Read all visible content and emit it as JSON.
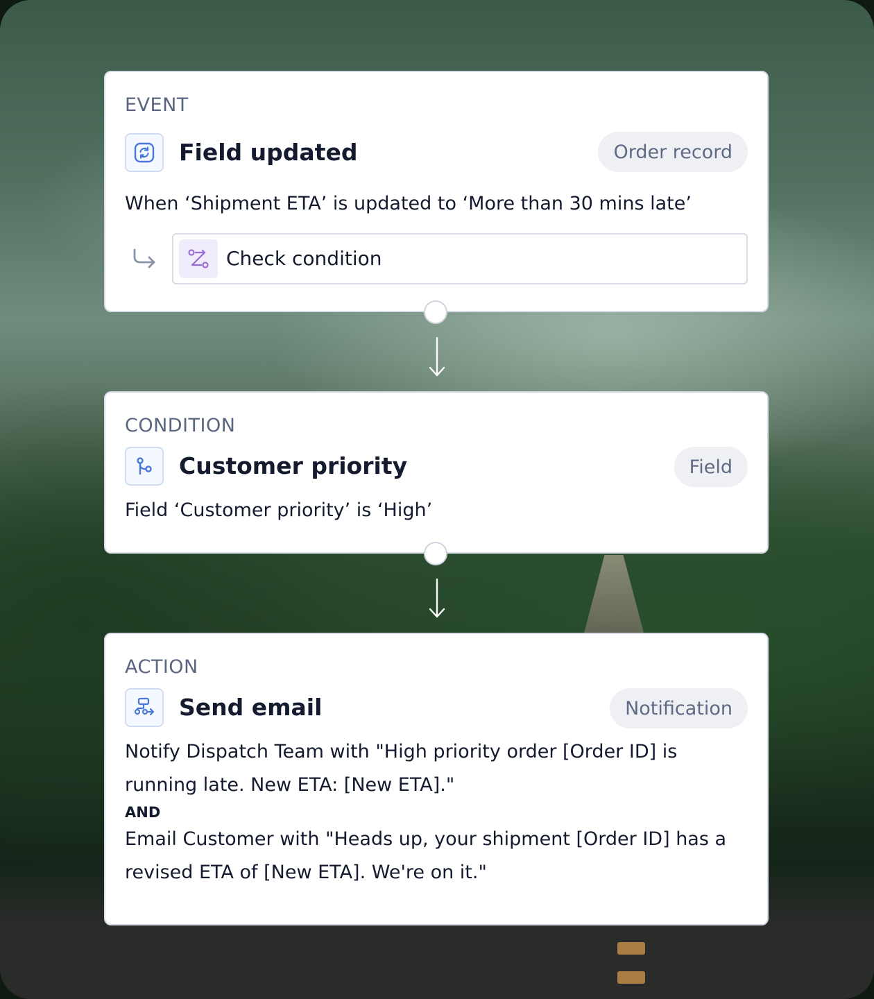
{
  "event": {
    "section_label": "EVENT",
    "icon": "refresh-icon",
    "title": "Field updated",
    "tag": "Order record",
    "description": "When ‘Shipment ETA’ is updated to ‘More than 30 mins late’",
    "sub_step": {
      "icon": "route-icon",
      "label": "Check condition"
    }
  },
  "condition": {
    "section_label": "CONDITION",
    "icon": "branch-icon",
    "title": "Customer priority",
    "tag": "Field",
    "description": "Field ‘Customer priority’ is ‘High’"
  },
  "action": {
    "section_label": "ACTION",
    "icon": "workflow-send-icon",
    "title": "Send email",
    "tag": "Notification",
    "description_1": "Notify Dispatch Team with \"High priority order [Order ID] is running late. New ETA: [New ETA].\"",
    "conjunction": "AND",
    "description_2": "Email Customer with \"Heads up, your shipment [Order ID] has a revised ETA of [New ETA]. We're on it.\""
  },
  "colors": {
    "accent_blue": "#4a78d6",
    "accent_purple": "#9b6cd8",
    "text_primary": "#141b2e",
    "text_secondary": "#5a6580"
  }
}
